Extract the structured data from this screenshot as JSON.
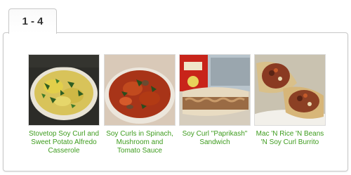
{
  "tab": {
    "label": "1 - 4"
  },
  "recipes": [
    {
      "title": "Stovetop Soy Curl and Sweet Potato Alfredo Casserole",
      "image": "casserole-photo"
    },
    {
      "title": "Soy Curls in Spinach, Mushroom and Tomato Sauce",
      "image": "tomato-sauce-photo"
    },
    {
      "title": "Soy Curl \"Paprikash\" Sandwich",
      "image": "sandwich-photo"
    },
    {
      "title": "Mac 'N Rice 'N Beans 'N Soy Curl Burrito",
      "image": "burrito-photo"
    }
  ],
  "colors": {
    "link": "#3e9c1e",
    "border": "#c8c8c8"
  }
}
